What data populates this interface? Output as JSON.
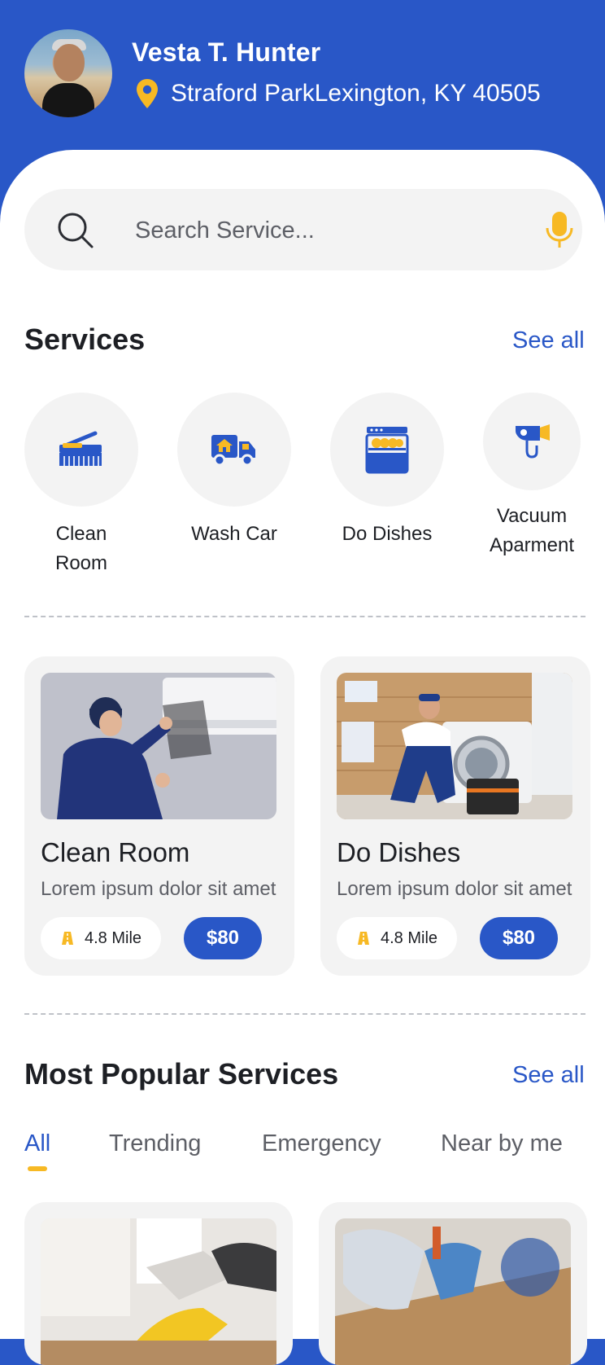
{
  "user": {
    "name": "Vesta T. Hunter",
    "address": "Straford ParkLexington, KY 40505"
  },
  "search": {
    "placeholder": "Search Service..."
  },
  "services": {
    "title": "Services",
    "see_all": "See all",
    "items": [
      {
        "label": "Clean Room",
        "icon": "broom-brush-icon"
      },
      {
        "label": "Wash Car",
        "icon": "delivery-truck-icon"
      },
      {
        "label": "Do Dishes",
        "icon": "dishwasher-icon"
      },
      {
        "label": "Vacuum Aparment",
        "icon": "vacuum-icon"
      }
    ]
  },
  "featured": [
    {
      "title": "Clean Room",
      "desc": "Lorem ipsum dolor sit amet",
      "distance": "4.8 Mile",
      "price": "$80",
      "image": "technician-cleaning-air-conditioner"
    },
    {
      "title": "Do Dishes",
      "desc": "Lorem ipsum dolor sit amet",
      "distance": "4.8 Mile",
      "price": "$80",
      "image": "repairman-fixing-washing-machine"
    }
  ],
  "popular": {
    "title": "Most Popular Services",
    "see_all": "See all",
    "tabs": [
      "All",
      "Trending",
      "Emergency",
      "Near by me"
    ],
    "active_tab": "All"
  },
  "colors": {
    "brand": "#2957c7",
    "accent": "#f7b924",
    "surface": "#f3f3f3"
  }
}
